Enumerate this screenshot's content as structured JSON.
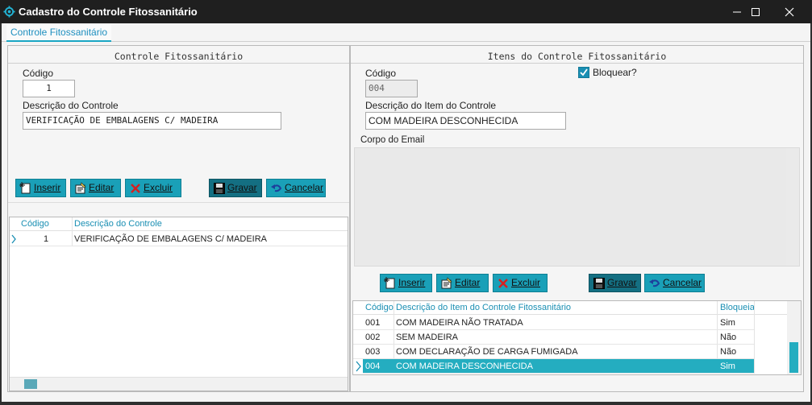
{
  "window": {
    "title": "Cadastro do Controle Fitossanitário"
  },
  "tabs": [
    {
      "label": "Controle Fitossanitário"
    }
  ],
  "left_panel": {
    "title": "Controle Fitossanitário",
    "codigo_label": "Código",
    "codigo_value": "1",
    "descricao_label": "Descrição do Controle",
    "descricao_value": "VERIFICAÇÃO DE EMBALAGENS C/ MADEIRA",
    "buttons": {
      "inserir": "Inserir",
      "editar": "Editar",
      "excluir": "Excluir",
      "gravar": "Gravar",
      "cancelar": "Cancelar"
    },
    "grid": {
      "columns": [
        "Código",
        "Descrição do Controle"
      ],
      "rows": [
        {
          "codigo": "1",
          "descricao": "VERIFICAÇÃO DE EMBALAGENS C/ MADEIRA"
        }
      ]
    }
  },
  "right_panel": {
    "title": "Itens do Controle Fitossanitário",
    "codigo_label": "Código",
    "codigo_value": "004",
    "bloquear_label": "Bloquear?",
    "bloquear_checked": true,
    "descricao_label": "Descrição do Item do Controle",
    "descricao_value": "COM MADEIRA DESCONHECIDA",
    "corpo_label": "Corpo do Email",
    "buttons": {
      "inserir": "Inserir",
      "editar": "Editar",
      "excluir": "Excluir",
      "gravar": "Gravar",
      "cancelar": "Cancelar"
    },
    "grid": {
      "columns": [
        "Código",
        "Descrição do Item do Controle Fitossanitário",
        "Bloqueia"
      ],
      "rows": [
        {
          "codigo": "001",
          "descricao": "COM MADEIRA NÃO TRATADA",
          "bloqueia": "Sim"
        },
        {
          "codigo": "002",
          "descricao": "SEM MADEIRA",
          "bloqueia": "Não"
        },
        {
          "codigo": "003",
          "descricao": "COM DECLARAÇÃO DE CARGA FUMIGADA",
          "bloqueia": "Não"
        },
        {
          "codigo": "004",
          "descricao": "COM MADEIRA DESCONHECIDA",
          "bloqueia": "Sim"
        }
      ],
      "selected_index": 3
    }
  },
  "colors": {
    "accent": "#1aa0b8",
    "selection": "#24adc0",
    "header_text": "#1a8fb3",
    "titlebar": "#1f1f1f"
  }
}
